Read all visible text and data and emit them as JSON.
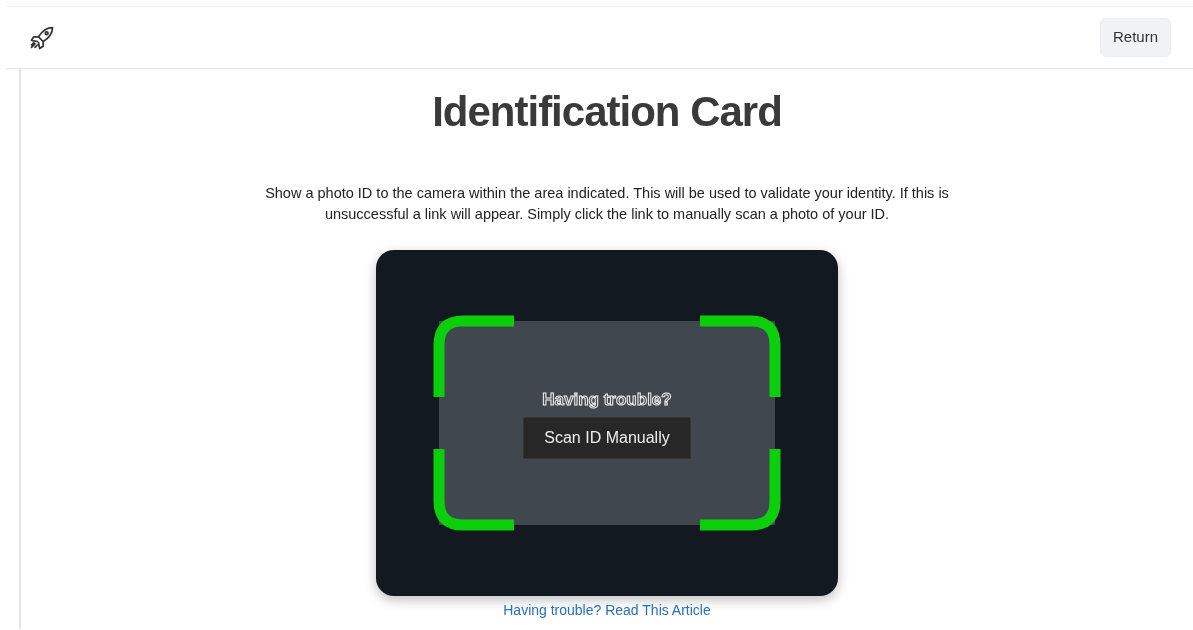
{
  "header": {
    "button": "Return"
  },
  "title": "Identification Card",
  "instructions": "Show a photo ID to the camera within the area indicated. This will be used to validate your identity. If this is unsuccessful a link will appear. Simply click the link to manually scan a photo of your ID.",
  "scanner": {
    "prompt": "Having trouble?",
    "button": "Scan ID Manually"
  },
  "help_link": "Having trouble? Read This Article"
}
